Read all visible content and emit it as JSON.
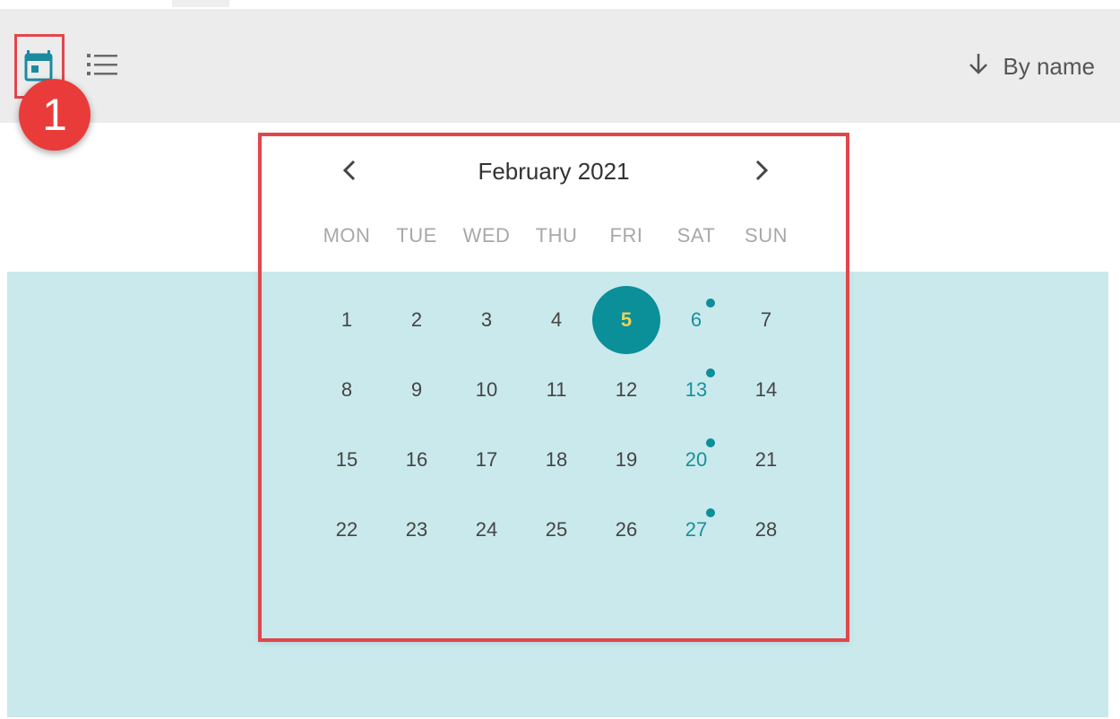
{
  "toolbar": {
    "calendar_view_icon": "calendar-icon",
    "list_view_icon": "list-icon",
    "sort_label": "By name",
    "sort_icon": "arrow-down-icon"
  },
  "annotation": {
    "badge_number": "1",
    "highlight_color": "#e0474c"
  },
  "calendar": {
    "month_title": "February 2021",
    "prev_icon": "chevron-left-icon",
    "next_icon": "chevron-right-icon",
    "weekdays": [
      "MON",
      "TUE",
      "WED",
      "THU",
      "FRI",
      "SAT",
      "SUN"
    ],
    "weeks": [
      [
        "1",
        "2",
        "3",
        "4",
        "5",
        "6",
        "7"
      ],
      [
        "8",
        "9",
        "10",
        "11",
        "12",
        "13",
        "14"
      ],
      [
        "15",
        "16",
        "17",
        "18",
        "19",
        "20",
        "21"
      ],
      [
        "22",
        "23",
        "24",
        "25",
        "26",
        "27",
        "28"
      ]
    ],
    "selected_day": "5",
    "days_with_events": [
      "6",
      "13",
      "20",
      "27"
    ],
    "accent_color": "#0b8f99"
  }
}
